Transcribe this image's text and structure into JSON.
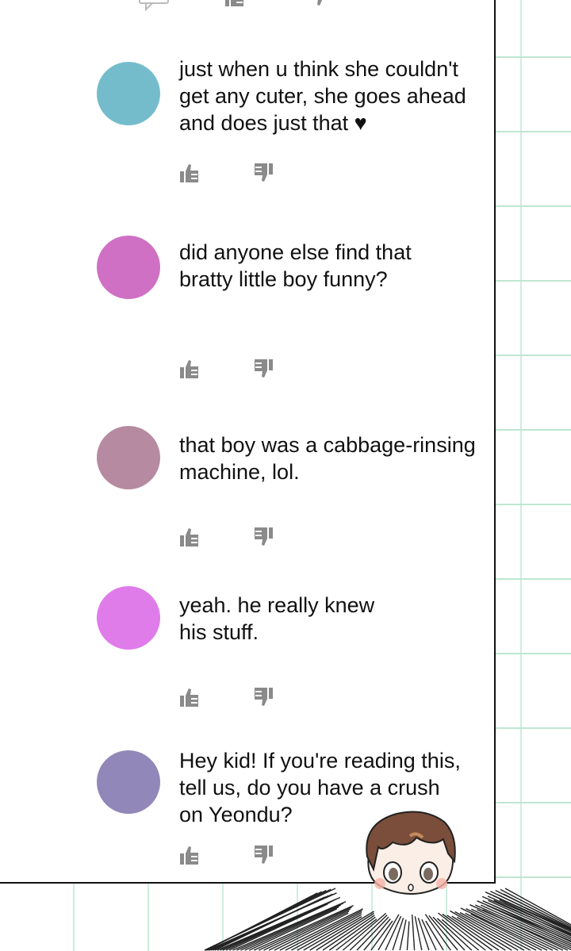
{
  "comments": [
    {
      "text": "just when u think she couldn't\nget any cuter, she goes ahead\nand does just that ♥",
      "avatar_color": "#74bccb"
    },
    {
      "text": "did anyone else find that\nbratty little boy funny?",
      "avatar_color": "#cf70c4"
    },
    {
      "text": "that boy was a cabbage-rinsing\nmachine, lol.",
      "avatar_color": "#b68aa1"
    },
    {
      "text": "yeah. he really knew\nhis stuff.",
      "avatar_color": "#e07bea"
    },
    {
      "text": "Hey kid! If you're reading this,\ntell us, do you have a crush\non Yeondu?",
      "avatar_color": "#9187b8"
    }
  ],
  "icons": {
    "comment": "comment-icon",
    "like": "thumbs-up-icon",
    "dislike": "thumbs-down-icon"
  },
  "colors": {
    "icon_gray": "#8a8a8a",
    "grid_green": "#bfe6d2",
    "border": "#111111"
  }
}
